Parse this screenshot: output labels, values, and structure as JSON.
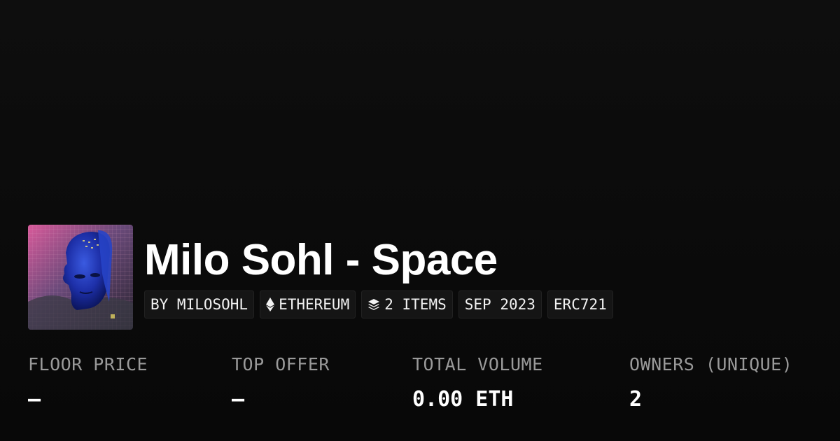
{
  "collection": {
    "title": "Milo Sohl - Space",
    "avatar_alt": "collection-avatar"
  },
  "badges": [
    {
      "label": "BY MILOSOHL",
      "icon": ""
    },
    {
      "label": "ETHEREUM",
      "icon": "ethereum-icon"
    },
    {
      "label": "2 ITEMS",
      "icon": "layers-icon"
    },
    {
      "label": "SEP 2023",
      "icon": ""
    },
    {
      "label": "ERC721",
      "icon": ""
    }
  ],
  "stats": [
    {
      "label": "FLOOR PRICE",
      "value": "–"
    },
    {
      "label": "TOP OFFER",
      "value": "–"
    },
    {
      "label": "TOTAL VOLUME",
      "value": "0.00 ETH"
    },
    {
      "label": "OWNERS (UNIQUE)",
      "value": "2"
    }
  ],
  "colors": {
    "background": "#0a0a0a",
    "badge_bg": "#151515",
    "label": "#9a9a9a",
    "text": "#ffffff"
  }
}
